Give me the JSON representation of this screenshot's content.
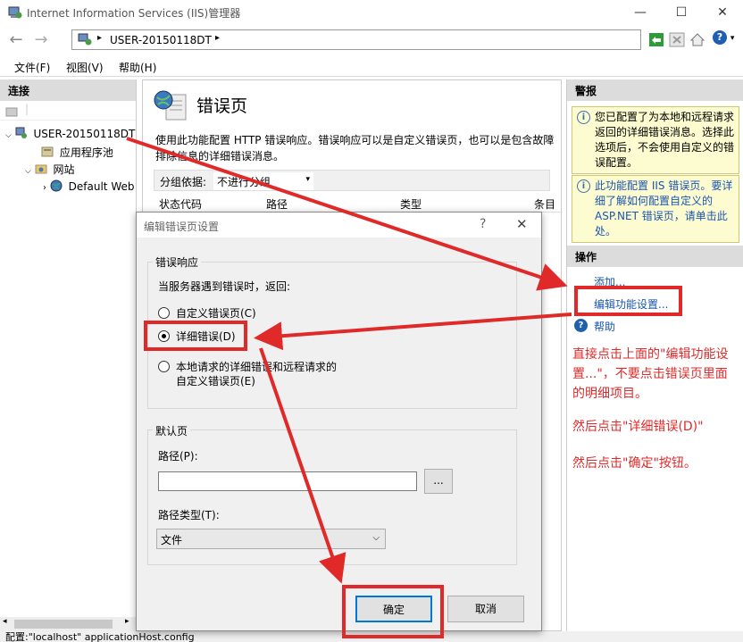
{
  "window": {
    "title": "Internet Information Services (IIS)管理器",
    "min": "—",
    "max": "☐",
    "close": "✕"
  },
  "nav": {
    "back": "←",
    "forward": "→",
    "address": "USER-20150118DT",
    "sep": "▸",
    "help": "?▾"
  },
  "menu": {
    "file": "文件(F)",
    "view": "视图(V)",
    "help": "帮助(H)"
  },
  "connections": {
    "header": "连接",
    "tree": {
      "server": "USER-20150118DT",
      "app_pools": "应用程序池",
      "sites": "网站",
      "default_site": "Default Web"
    }
  },
  "center": {
    "title": "错误页",
    "description": "使用此功能配置 HTTP 错误响应。错误响应可以是自定义错误页，也可以是包含故障排除信息的详细错误消息。",
    "group_label": "分组依据:",
    "group_value": "不进行分组",
    "columns": {
      "status": "状态代码",
      "path": "路径",
      "type": "类型",
      "extra": "条目"
    }
  },
  "alerts": {
    "header": "警报",
    "msg1": "您已配置了为本地和远程请求返回的详细错误消息。选择此选项后，不会使用自定义的错误配置。",
    "msg2": "此功能配置 IIS 错误页。要详细了解如何配置自定义的 ASP.NET 错误页，请单击此处。"
  },
  "actions": {
    "header": "操作",
    "add": "添加...",
    "edit": "编辑功能设置...",
    "help": "帮助"
  },
  "annotations": {
    "note1": "直接点击上面的\"编辑功能设置...\"，不要点击错误页里面的明细项目。",
    "note2": "然后点击\"详细错误(D)\"",
    "note3": "然后点击\"确定\"按钮。"
  },
  "dialog": {
    "title": "编辑错误页设置",
    "help": "?",
    "close": "✕",
    "error_group": "错误响应",
    "prompt": "当服务器遇到错误时，返回:",
    "opt_custom": "自定义错误页(C)",
    "opt_detailed": "详细错误(D)",
    "opt_local_line1": "本地请求的详细错误和远程请求的",
    "opt_local_line2": "自定义错误页(E)",
    "default_group": "默认页",
    "path_label": "路径(P):",
    "path_value": "",
    "browse": "...",
    "path_type_label": "路径类型(T):",
    "path_type_value": "文件",
    "ok": "确定",
    "cancel": "取消"
  },
  "statusbar": {
    "text": "配置:\"localhost\" applicationHost.config"
  },
  "colors": {
    "highlight": "#e02a2a",
    "link": "#1a56b0"
  }
}
